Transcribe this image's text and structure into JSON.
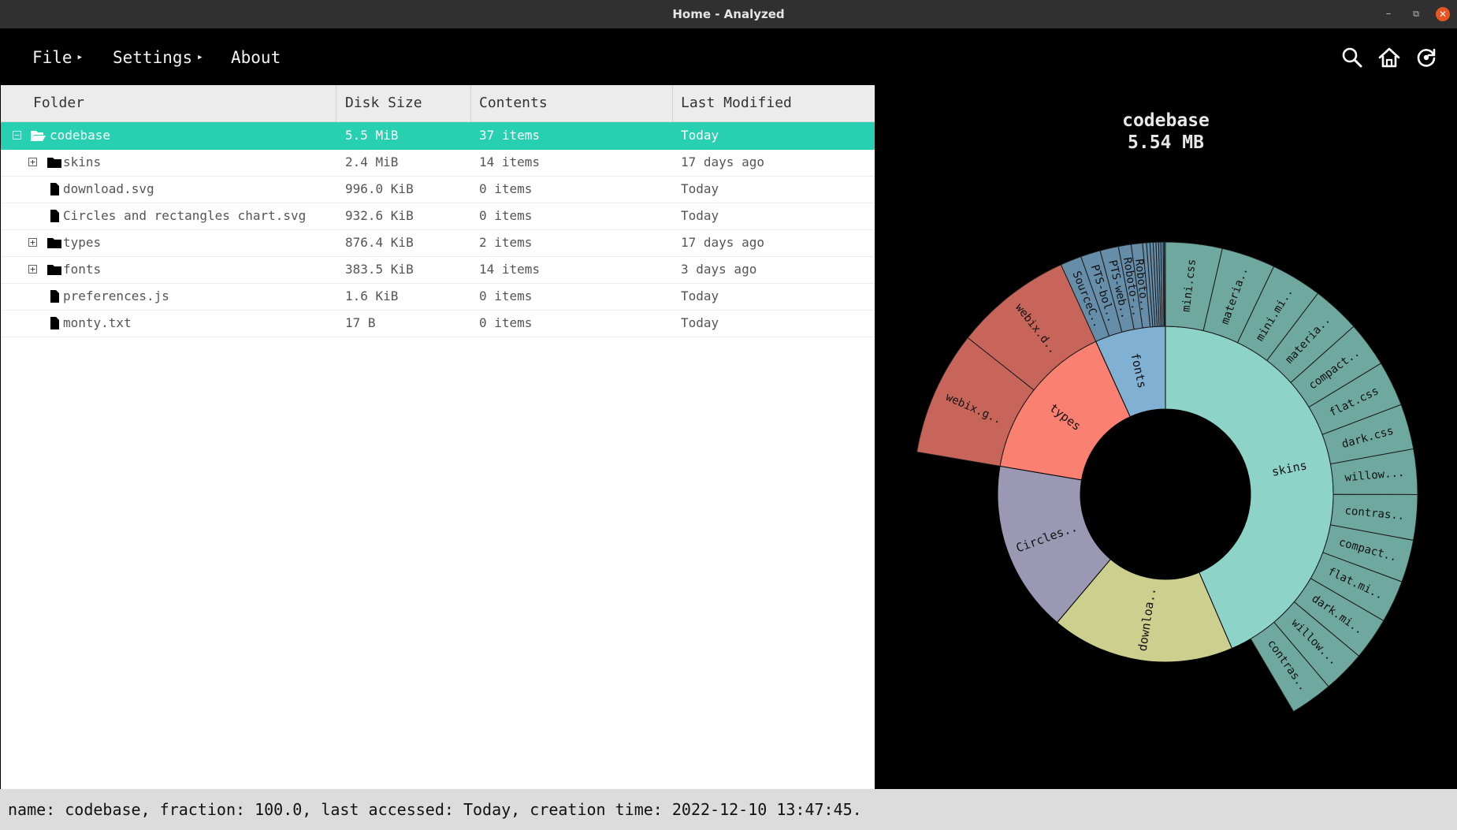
{
  "window": {
    "title": "Home - Analyzed"
  },
  "menu": {
    "file": "File",
    "settings": "Settings",
    "about": "About"
  },
  "toolbar": {
    "icons": [
      "search-icon",
      "home-icon",
      "refresh-icon"
    ]
  },
  "table": {
    "columns": [
      "Folder",
      "Disk Size",
      "Contents",
      "Last Modified"
    ],
    "rows": [
      {
        "name": "codebase",
        "size": "5.5 MiB",
        "contents": "37 items",
        "modified": "Today",
        "kind": "folder-open",
        "toggle": "⊟",
        "selected": true
      },
      {
        "name": "skins",
        "size": "2.4 MiB",
        "contents": "14 items",
        "modified": "17 days ago",
        "kind": "folder",
        "toggle": "⊞"
      },
      {
        "name": "download.svg",
        "size": "996.0 KiB",
        "contents": "0 items",
        "modified": "Today",
        "kind": "file"
      },
      {
        "name": "Circles and rectangles chart.svg",
        "size": "932.6 KiB",
        "contents": "0 items",
        "modified": "Today",
        "kind": "file"
      },
      {
        "name": "types",
        "size": "876.4 KiB",
        "contents": "2 items",
        "modified": "17 days ago",
        "kind": "folder",
        "toggle": "⊞"
      },
      {
        "name": "fonts",
        "size": "383.5 KiB",
        "contents": "14 items",
        "modified": "3 days ago",
        "kind": "folder",
        "toggle": "⊞"
      },
      {
        "name": "preferences.js",
        "size": "1.6 KiB",
        "contents": "0 items",
        "modified": "Today",
        "kind": "file"
      },
      {
        "name": "monty.txt",
        "size": "17 B",
        "contents": "0 items",
        "modified": "Today",
        "kind": "file"
      }
    ]
  },
  "chart": {
    "title": "codebase",
    "subtitle": "5.54 MB"
  },
  "chart_data": {
    "type": "sunburst",
    "root": "codebase",
    "colors": {
      "skins": "#8dd3c7",
      "download": "#cdcf8e",
      "circles": "#9a98b3",
      "types": "#fa8072",
      "fonts": "#80b1d3"
    },
    "inner": [
      {
        "label": "skins",
        "value": 2.4,
        "color": "#8dd3c7"
      },
      {
        "label": "downloa..",
        "value": 0.973,
        "color": "#cdcf8e"
      },
      {
        "label": "Circles..",
        "value": 0.911,
        "color": "#9a98b3"
      },
      {
        "label": "types",
        "value": 0.856,
        "color": "#fa8072"
      },
      {
        "label": "fonts",
        "value": 0.375,
        "color": "#80b1d3"
      }
    ],
    "outer": [
      {
        "parent": "skins",
        "label": "mini.css",
        "value": 0.2,
        "color": "#6fa89e"
      },
      {
        "parent": "skins",
        "label": "materia..",
        "value": 0.19,
        "color": "#6fa89e"
      },
      {
        "parent": "skins",
        "label": "mini.mi..",
        "value": 0.18,
        "color": "#6fa89e"
      },
      {
        "parent": "skins",
        "label": "materia..",
        "value": 0.17,
        "color": "#6fa89e"
      },
      {
        "parent": "skins",
        "label": "compact..",
        "value": 0.16,
        "color": "#6fa89e"
      },
      {
        "parent": "skins",
        "label": "flat.css",
        "value": 0.16,
        "color": "#6fa89e"
      },
      {
        "parent": "skins",
        "label": "dark.css",
        "value": 0.16,
        "color": "#6fa89e"
      },
      {
        "parent": "skins",
        "label": "willow...",
        "value": 0.16,
        "color": "#6fa89e"
      },
      {
        "parent": "skins",
        "label": "contras..",
        "value": 0.16,
        "color": "#6fa89e"
      },
      {
        "parent": "skins",
        "label": "compact..",
        "value": 0.15,
        "color": "#6fa89e"
      },
      {
        "parent": "skins",
        "label": "flat.mi..",
        "value": 0.15,
        "color": "#6fa89e"
      },
      {
        "parent": "skins",
        "label": "dark.mi..",
        "value": 0.15,
        "color": "#6fa89e"
      },
      {
        "parent": "skins",
        "label": "willow...",
        "value": 0.15,
        "color": "#6fa89e"
      },
      {
        "parent": "skins",
        "label": "contras..",
        "value": 0.15,
        "color": "#6fa89e"
      },
      {
        "parent": "types",
        "label": "webix.g..",
        "value": 0.44,
        "color": "#c8655b"
      },
      {
        "parent": "types",
        "label": "webix.d..",
        "value": 0.416,
        "color": "#c8655b"
      },
      {
        "parent": "fonts",
        "label": "SourceC..",
        "value": 0.075,
        "color": "#668ea9"
      },
      {
        "parent": "fonts",
        "label": "PTS-bol..",
        "value": 0.07,
        "color": "#668ea9"
      },
      {
        "parent": "fonts",
        "label": "PTS-web..",
        "value": 0.065,
        "color": "#668ea9"
      },
      {
        "parent": "fonts",
        "label": "Roboto-..",
        "value": 0.045,
        "color": "#668ea9"
      },
      {
        "parent": "fonts",
        "label": "Roboto..",
        "value": 0.04,
        "color": "#668ea9"
      },
      {
        "parent": "fonts",
        "label": "",
        "value": 0.014,
        "color": "#668ea9"
      },
      {
        "parent": "fonts",
        "label": "",
        "value": 0.012,
        "color": "#668ea9"
      },
      {
        "parent": "fonts",
        "label": "",
        "value": 0.011,
        "color": "#668ea9"
      },
      {
        "parent": "fonts",
        "label": "",
        "value": 0.01,
        "color": "#668ea9"
      },
      {
        "parent": "fonts",
        "label": "",
        "value": 0.009,
        "color": "#668ea9"
      },
      {
        "parent": "fonts",
        "label": "",
        "value": 0.008,
        "color": "#668ea9"
      },
      {
        "parent": "fonts",
        "label": "",
        "value": 0.008,
        "color": "#668ea9"
      },
      {
        "parent": "fonts",
        "label": "",
        "value": 0.004,
        "color": "#668ea9"
      },
      {
        "parent": "fonts",
        "label": "",
        "value": 0.004,
        "color": "#668ea9"
      }
    ]
  },
  "status": {
    "text": "name: codebase, fraction: 100.0, last accessed: Today, creation time: 2022-12-10 13:47:45."
  }
}
